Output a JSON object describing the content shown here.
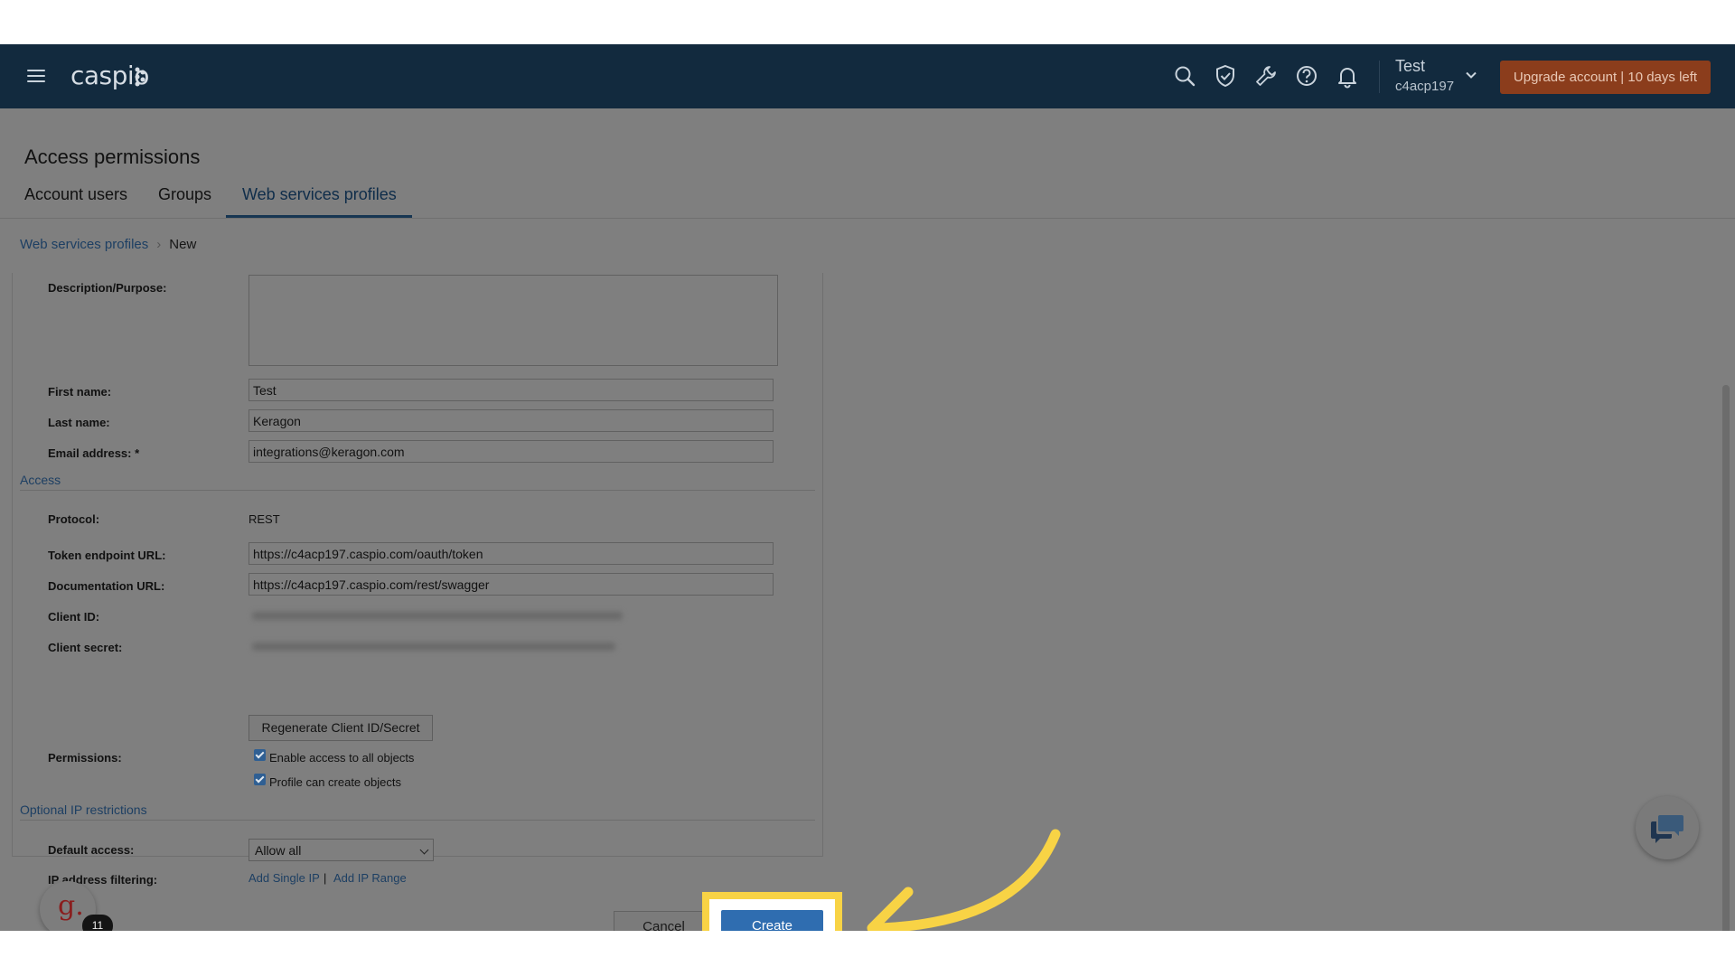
{
  "header": {
    "logo": "caspio",
    "user_name": "Test",
    "user_id": "c4acp197",
    "upgrade_label": "Upgrade account  |  10 days left",
    "icons": [
      "search-icon",
      "shield-icon",
      "wrench-icon",
      "help-icon",
      "bell-icon"
    ]
  },
  "page": {
    "title": "Access permissions",
    "tabs": [
      "Account users",
      "Groups",
      "Web services profiles"
    ],
    "active_tab": "Web services profiles"
  },
  "breadcrumb": {
    "parent": "Web services profiles",
    "current": "New"
  },
  "form": {
    "description_label": "Description/Purpose:",
    "first_name_label": "First name:",
    "first_name_value": "Test",
    "last_name_label": "Last name:",
    "last_name_value": "Keragon",
    "email_label": "Email address: *",
    "email_value": "integrations@keragon.com",
    "access_section": "Access",
    "protocol_label": "Protocol:",
    "protocol_value": "REST",
    "token_label": "Token endpoint URL:",
    "token_value": "https://c4acp197.caspio.com/oauth/token",
    "docs_label": "Documentation URL:",
    "docs_value": "https://c4acp197.caspio.com/rest/swagger",
    "client_id_label": "Client ID:",
    "client_secret_label": "Client secret:",
    "regenerate_label": "Regenerate Client ID/Secret",
    "permissions_label": "Permissions:",
    "perm_all_label": "Enable access to all objects",
    "perm_create_label": "Profile can create objects",
    "ip_section": "Optional IP restrictions",
    "default_access_label": "Default access:",
    "default_access_value": "Allow all",
    "ip_filter_label": "IP address filtering:",
    "add_single_ip": "Add Single IP",
    "separator": "|",
    "add_ip_range": "Add IP Range"
  },
  "actions": {
    "cancel_label": "Cancel",
    "create_label": "Create"
  },
  "widgets": {
    "g_letter": "g.",
    "g_badge": "11"
  },
  "colors": {
    "topbar": "#122a3e",
    "upgrade": "#8b3d1c",
    "create": "#2f6db0",
    "highlight": "#f8d345"
  }
}
